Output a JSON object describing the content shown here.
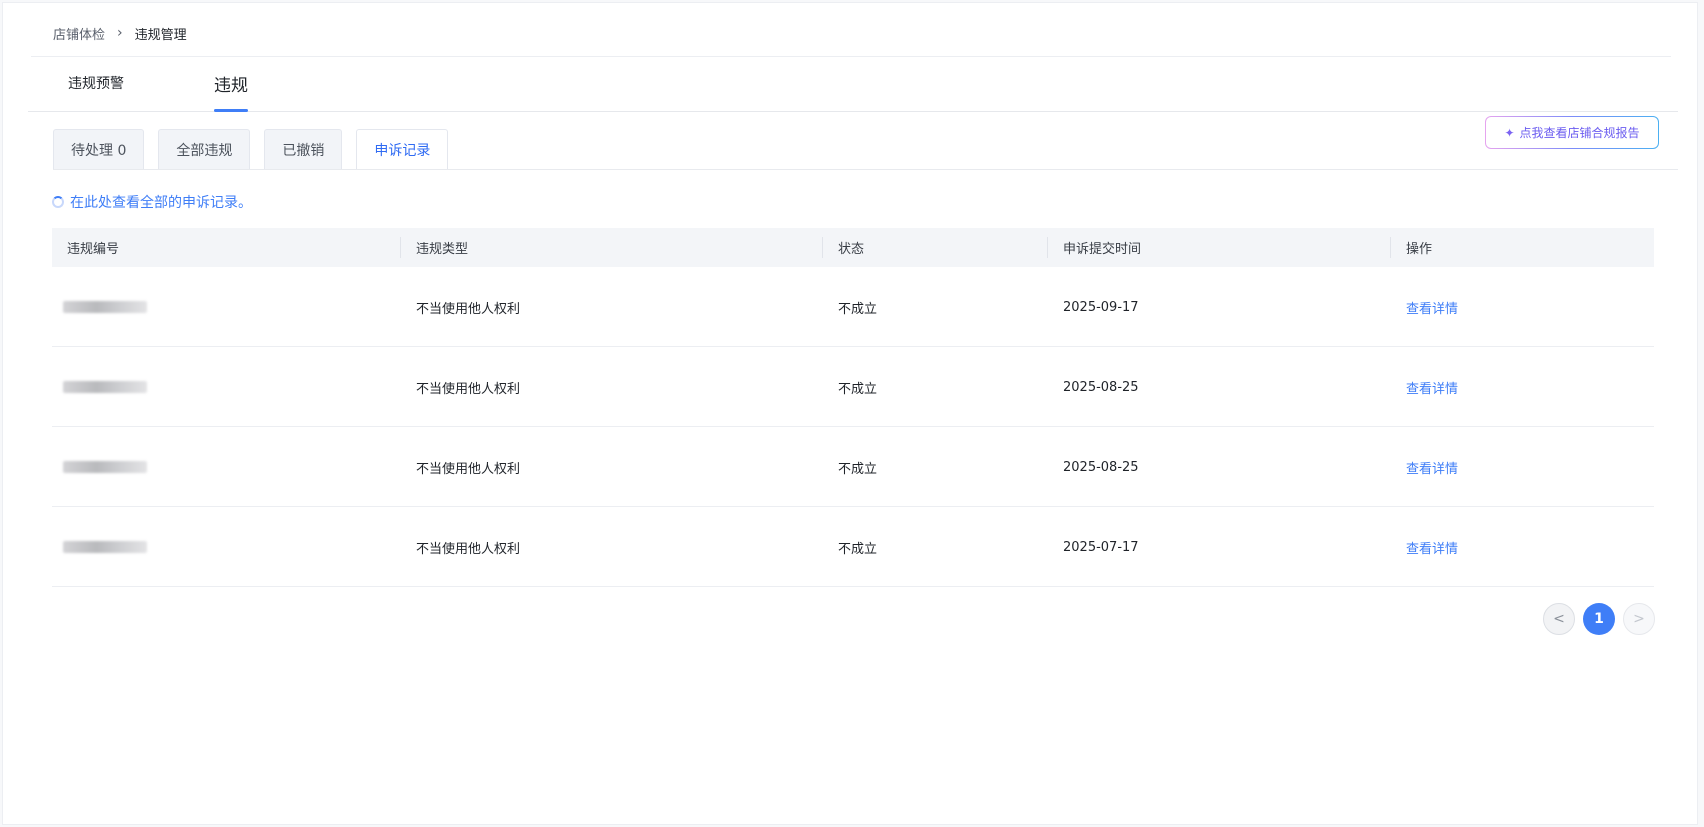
{
  "breadcrumb": {
    "parent": "店铺体检",
    "separator": "›",
    "current": "违规管理"
  },
  "main_tabs": [
    {
      "label": "违规预警",
      "active": false
    },
    {
      "label": "违规",
      "active": true
    }
  ],
  "sub_tabs": [
    {
      "label": "待处理 0",
      "active": false
    },
    {
      "label": "全部违规",
      "active": false
    },
    {
      "label": "已撤销",
      "active": false
    },
    {
      "label": "申诉记录",
      "active": true
    }
  ],
  "report_button": {
    "label": "点我查看店铺合规报告",
    "icon": "sparkle-icon"
  },
  "notice": {
    "text": "在此处查看全部的申诉记录。"
  },
  "table": {
    "columns": [
      "违规编号",
      "违规类型",
      "状态",
      "申诉提交时间",
      "操作"
    ],
    "rows": [
      {
        "type": "不当使用他人权利",
        "status": "不成立",
        "time": "2025-09-17",
        "action": "查看详情"
      },
      {
        "type": "不当使用他人权利",
        "status": "不成立",
        "time": "2025-08-25",
        "action": "查看详情"
      },
      {
        "type": "不当使用他人权利",
        "status": "不成立",
        "time": "2025-08-25",
        "action": "查看详情"
      },
      {
        "type": "不当使用他人权利",
        "status": "不成立",
        "time": "2025-07-17",
        "action": "查看详情"
      }
    ]
  },
  "pagination": {
    "prev": "<",
    "current_page": "1",
    "next": ">"
  },
  "colors": {
    "accent": "#3f7ef7",
    "report_text": "#6b5cf0"
  }
}
